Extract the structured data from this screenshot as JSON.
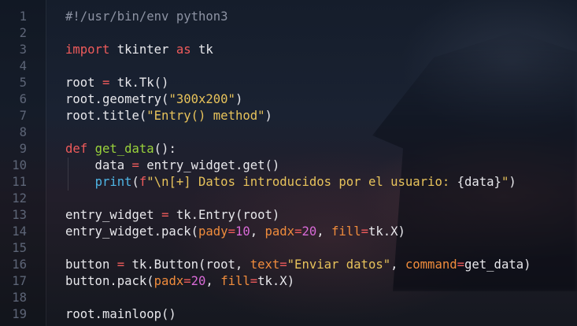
{
  "colors": {
    "comment": "#8d93a3",
    "keyword": "#ef5b5b",
    "string": "#e8c35b",
    "number": "#d86ad6",
    "parameter": "#f08c3c",
    "function_name": "#9ad33b",
    "builtin": "#4fb6e6",
    "default_text": "#e8e8ec",
    "line_number": "#5d6577"
  },
  "lines": [
    {
      "n": "1",
      "tokens": [
        {
          "t": "#!/usr/bin/env python3",
          "c": "comment"
        }
      ]
    },
    {
      "n": "2",
      "tokens": []
    },
    {
      "n": "3",
      "tokens": [
        {
          "t": "import",
          "c": "kw"
        },
        {
          "t": " tkinter ",
          "c": ""
        },
        {
          "t": "as",
          "c": "kw"
        },
        {
          "t": " tk",
          "c": ""
        }
      ]
    },
    {
      "n": "4",
      "tokens": []
    },
    {
      "n": "5",
      "tokens": [
        {
          "t": "root ",
          "c": ""
        },
        {
          "t": "=",
          "c": "op"
        },
        {
          "t": " tk.Tk()",
          "c": ""
        }
      ]
    },
    {
      "n": "6",
      "tokens": [
        {
          "t": "root.geometry(",
          "c": ""
        },
        {
          "t": "\"300x200\"",
          "c": "str"
        },
        {
          "t": ")",
          "c": ""
        }
      ]
    },
    {
      "n": "7",
      "tokens": [
        {
          "t": "root.title(",
          "c": ""
        },
        {
          "t": "\"Entry() method\"",
          "c": "str"
        },
        {
          "t": ")",
          "c": ""
        }
      ]
    },
    {
      "n": "8",
      "tokens": []
    },
    {
      "n": "9",
      "tokens": [
        {
          "t": "def",
          "c": "kw"
        },
        {
          "t": " ",
          "c": ""
        },
        {
          "t": "get_data",
          "c": "func"
        },
        {
          "t": "():",
          "c": ""
        }
      ]
    },
    {
      "n": "10",
      "indent": true,
      "tokens": [
        {
          "t": "    data ",
          "c": ""
        },
        {
          "t": "=",
          "c": "op"
        },
        {
          "t": " entry_widget.get()",
          "c": ""
        }
      ]
    },
    {
      "n": "11",
      "indent": true,
      "tokens": [
        {
          "t": "    ",
          "c": ""
        },
        {
          "t": "print",
          "c": "builtin"
        },
        {
          "t": "(",
          "c": ""
        },
        {
          "t": "f",
          "c": "kw"
        },
        {
          "t": "\"\\n[+] Datos introducidos por el usuario: ",
          "c": "str"
        },
        {
          "t": "{data}",
          "c": ""
        },
        {
          "t": "\"",
          "c": "str"
        },
        {
          "t": ")",
          "c": ""
        }
      ]
    },
    {
      "n": "12",
      "tokens": []
    },
    {
      "n": "13",
      "tokens": [
        {
          "t": "entry_widget ",
          "c": ""
        },
        {
          "t": "=",
          "c": "op"
        },
        {
          "t": " tk.Entry(root)",
          "c": ""
        }
      ]
    },
    {
      "n": "14",
      "tokens": [
        {
          "t": "entry_widget.pack(",
          "c": ""
        },
        {
          "t": "pady",
          "c": "param"
        },
        {
          "t": "=",
          "c": "op"
        },
        {
          "t": "10",
          "c": "num"
        },
        {
          "t": ", ",
          "c": ""
        },
        {
          "t": "padx",
          "c": "param"
        },
        {
          "t": "=",
          "c": "op"
        },
        {
          "t": "20",
          "c": "num"
        },
        {
          "t": ", ",
          "c": ""
        },
        {
          "t": "fill",
          "c": "param"
        },
        {
          "t": "=",
          "c": "op"
        },
        {
          "t": "tk.X)",
          "c": ""
        }
      ]
    },
    {
      "n": "15",
      "tokens": []
    },
    {
      "n": "16",
      "tokens": [
        {
          "t": "button ",
          "c": ""
        },
        {
          "t": "=",
          "c": "op"
        },
        {
          "t": " tk.Button(root, ",
          "c": ""
        },
        {
          "t": "text",
          "c": "param"
        },
        {
          "t": "=",
          "c": "op"
        },
        {
          "t": "\"Enviar datos\"",
          "c": "str"
        },
        {
          "t": ", ",
          "c": ""
        },
        {
          "t": "command",
          "c": "param"
        },
        {
          "t": "=",
          "c": "op"
        },
        {
          "t": "get_data)",
          "c": ""
        }
      ]
    },
    {
      "n": "17",
      "tokens": [
        {
          "t": "button.pack(",
          "c": ""
        },
        {
          "t": "padx",
          "c": "param"
        },
        {
          "t": "=",
          "c": "op"
        },
        {
          "t": "20",
          "c": "num"
        },
        {
          "t": ", ",
          "c": ""
        },
        {
          "t": "fill",
          "c": "param"
        },
        {
          "t": "=",
          "c": "op"
        },
        {
          "t": "tk.X)",
          "c": ""
        }
      ]
    },
    {
      "n": "18",
      "tokens": []
    },
    {
      "n": "19",
      "tokens": [
        {
          "t": "root.mainloop()",
          "c": ""
        }
      ]
    }
  ]
}
